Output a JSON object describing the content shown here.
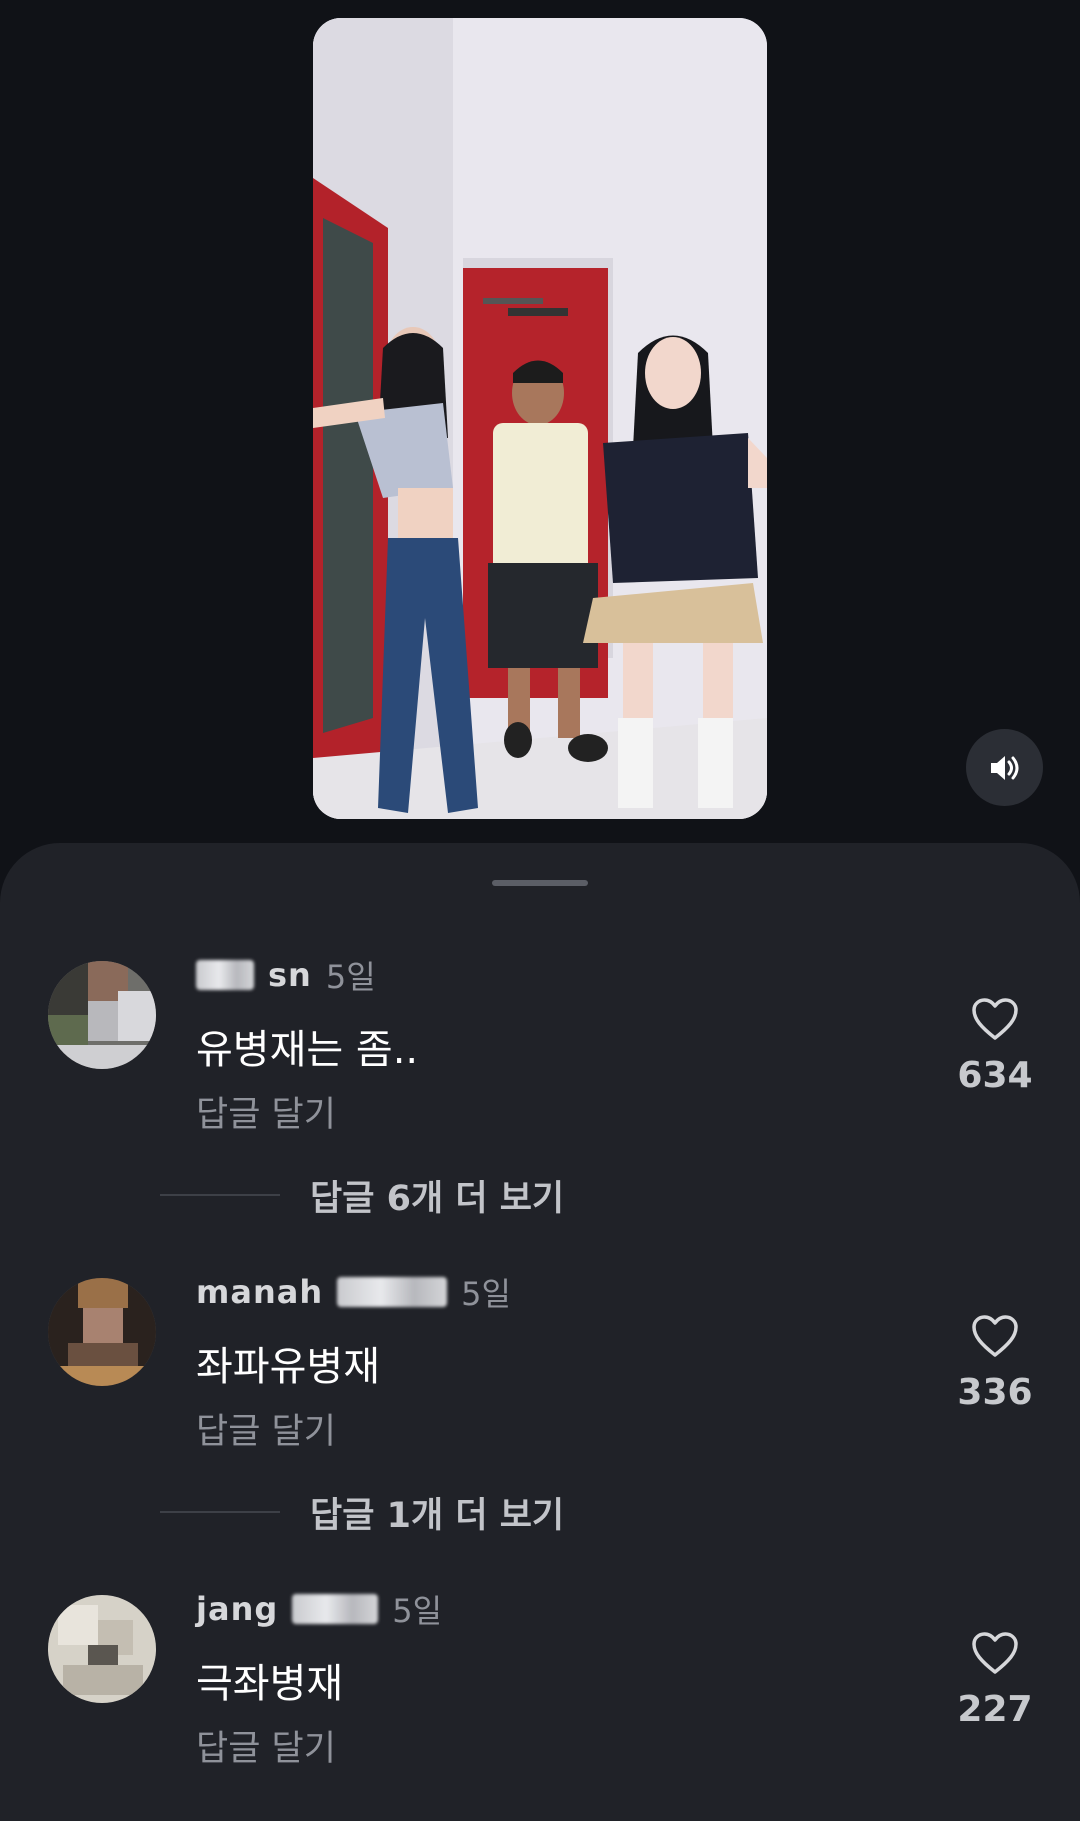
{
  "video": {
    "mute_icon": "speaker-icon"
  },
  "comments": [
    {
      "username": "sn",
      "time": "5일",
      "text": "유병재는 좀..",
      "reply_label": "답글 달기",
      "likes": "634",
      "more_replies": "답글 6개 더 보기"
    },
    {
      "username": "manah",
      "time": "5일",
      "text": "좌파유병재",
      "reply_label": "답글 달기",
      "likes": "336",
      "more_replies": "답글 1개 더 보기"
    },
    {
      "username": "jang",
      "time": "5일",
      "text": "극좌병재",
      "reply_label": "답글 달기",
      "likes": "227"
    }
  ],
  "colors": {
    "background": "#101217",
    "sheet": "#202228",
    "muted_text": "#8f929a"
  }
}
